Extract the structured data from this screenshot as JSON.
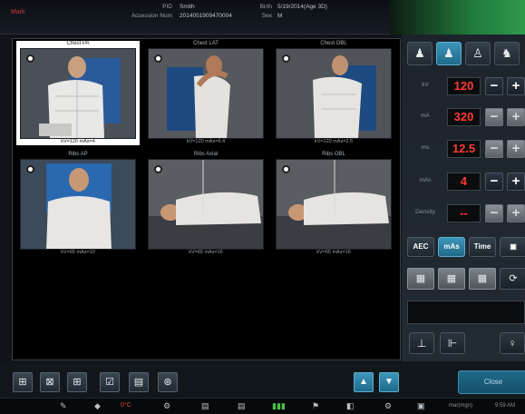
{
  "header": {
    "patient_name": "Mark",
    "pid_label": "PID",
    "pid_value": "Smith",
    "accession_label": "Accession Num",
    "accession_value": "2014051909470004",
    "birth_label": "Birth",
    "birth_value": "5/19/2014(Age 3D)",
    "sex_label": "Sex",
    "sex_value": "M"
  },
  "thumbnails": [
    {
      "title": "Chest PA",
      "params": "kV=120 mAs=4",
      "selected": true
    },
    {
      "title": "Chest LAT",
      "params": "kV=120 mAs=6.4",
      "selected": false
    },
    {
      "title": "Chest OBL",
      "params": "kV=120 mAs=2.5",
      "selected": false
    },
    {
      "title": "Ribs AP",
      "params": "kV=65 mAs=10",
      "selected": false
    },
    {
      "title": "Ribs Axial",
      "params": "kV=65 mAs=16",
      "selected": false
    },
    {
      "title": "Ribs OBL",
      "params": "kV=65 mAs=16",
      "selected": false
    }
  ],
  "panel": {
    "positions": [
      {
        "icon": "standing-person-icon"
      },
      {
        "icon": "standing-person-active-icon"
      },
      {
        "icon": "side-person-icon"
      },
      {
        "icon": "seated-person-icon"
      }
    ],
    "params": [
      {
        "label": "kV",
        "value": "120",
        "minus_dim": false
      },
      {
        "label": "mA",
        "value": "320",
        "minus_dim": true
      },
      {
        "label": "ms",
        "value": "12.5",
        "minus_dim": true
      },
      {
        "label": "mAs",
        "value": "4",
        "minus_dim": false
      },
      {
        "label": "Density",
        "value": "--",
        "minus_dim": true
      }
    ],
    "modes": [
      "AEC",
      "mAs",
      "Time"
    ],
    "active_mode": "mAs"
  },
  "toolbar": {
    "close_label": "Close"
  },
  "taskbar": {
    "temperature": "0°C",
    "user": "mar(mgn)",
    "time": "9:59 AM"
  },
  "colors": {
    "accent": "#3c95b8",
    "value_red": "#ff3a32",
    "header_green": "#2f9a4c"
  }
}
